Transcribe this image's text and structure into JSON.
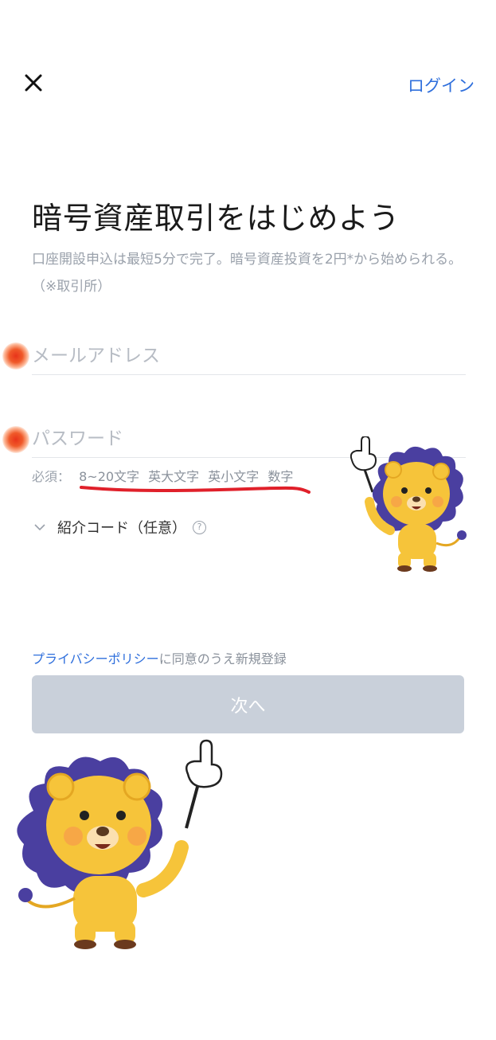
{
  "header": {
    "close_icon": "close-icon",
    "login_label": "ログイン"
  },
  "hero": {
    "title": "暗号資産取引をはじめよう",
    "subtitle": "口座開設申込は最短5分で完了。暗号資産投資を2円*から始められる。（※取引所）"
  },
  "form": {
    "email_placeholder": "メールアドレス",
    "email_value": "",
    "password_placeholder": "パスワード",
    "password_value": "",
    "requirements_label": "必須：",
    "requirements": [
      "8~20文字",
      "英大文字",
      "英小文字",
      "数字"
    ],
    "referral_label": "紹介コード（任意）",
    "referral_help": "?"
  },
  "consent": {
    "link_text": "プライバシーポリシー",
    "rest_text": "に同意のうえ新規登録"
  },
  "next_button_label": "次へ",
  "colors": {
    "accent": "#2f6fdc",
    "button_disabled": "#c9d0da",
    "annotation_red": "#e0202a",
    "mascot_yellow": "#f6c43a",
    "mascot_mane": "#4a3fa0"
  }
}
